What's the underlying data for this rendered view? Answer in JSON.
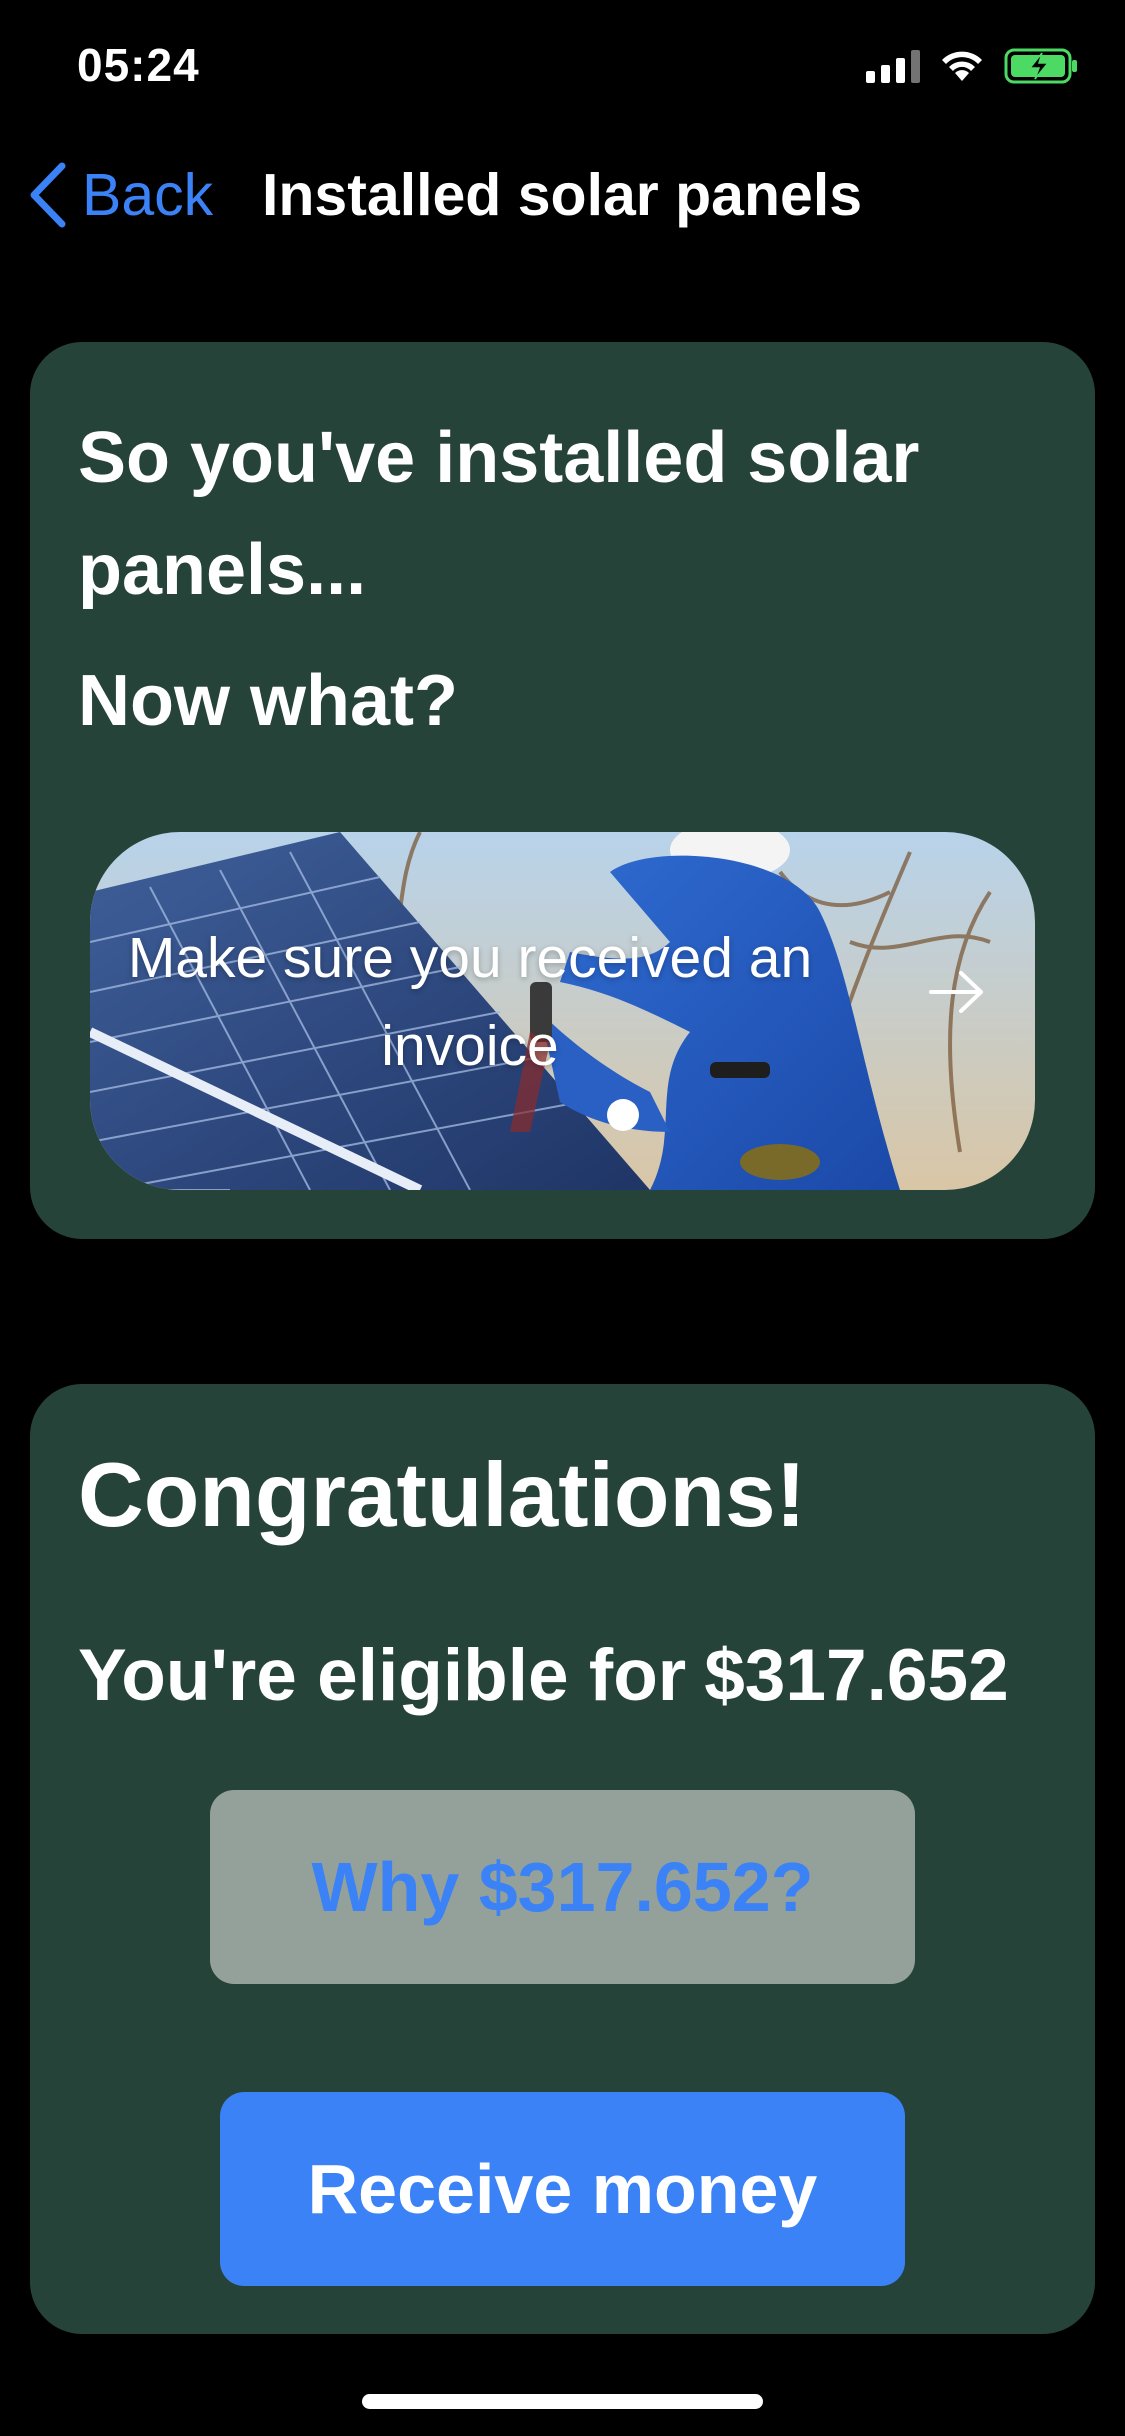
{
  "status_bar": {
    "time": "05:24",
    "icons": [
      "signal-icon",
      "wifi-icon",
      "battery-charging-icon"
    ],
    "battery_color": "#4cd964"
  },
  "nav": {
    "back_label": "Back",
    "title": "Installed solar panels"
  },
  "card_intro": {
    "heading": "So you've installed solar panels...",
    "subheading": "Now what?",
    "banner": {
      "text": "Make sure you received an invoice",
      "arrow_icon": "arrow-right-icon",
      "image": "solar-panel-installer-photo"
    }
  },
  "card_reward": {
    "title": "Congratulations!",
    "eligible_prefix": "You're eligible for",
    "eligible_amount": "$317.652",
    "why_button": "Why $317.652?",
    "receive_button": "Receive money"
  },
  "colors": {
    "background": "#000000",
    "card": "#264339",
    "accent": "#3b82f6",
    "why_button_bg": "#94a19a"
  }
}
